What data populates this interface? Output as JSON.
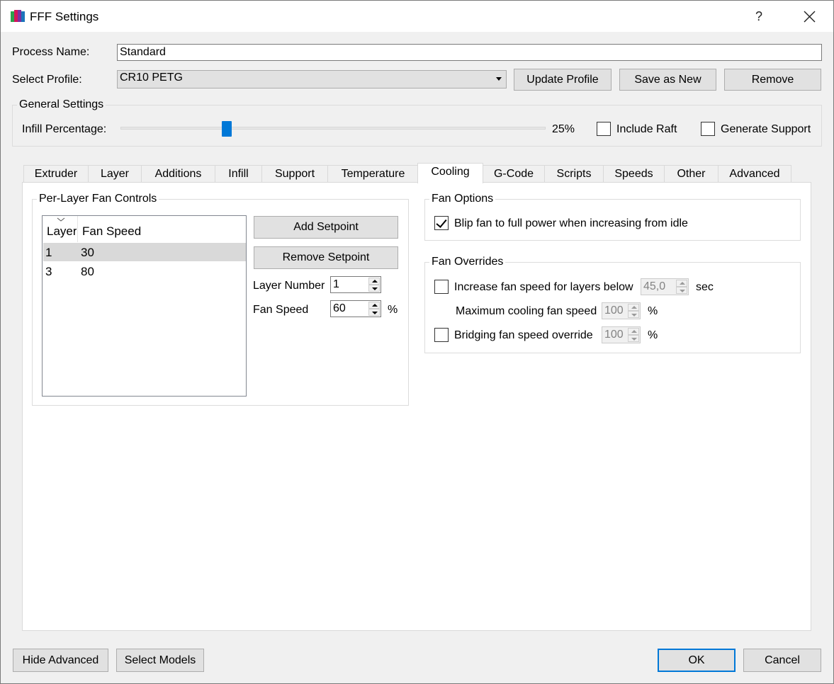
{
  "window": {
    "title": "FFF Settings",
    "help_label": "?",
    "close_icon": "close-icon",
    "app_icon": "simplify3d-icon"
  },
  "process": {
    "name_label": "Process Name:",
    "name_value": "Standard",
    "profile_label": "Select Profile:",
    "profile_value": "CR10 PETG",
    "update_profile": "Update Profile",
    "save_as_new": "Save as New",
    "remove": "Remove"
  },
  "general_settings": {
    "title": "General Settings",
    "infill_label": "Infill Percentage:",
    "infill_value": "25%",
    "infill_percent": 25,
    "include_raft": {
      "label": "Include Raft",
      "checked": false
    },
    "generate_support": {
      "label": "Generate Support",
      "checked": false
    }
  },
  "tabs": [
    {
      "label": "Extruder",
      "active": false
    },
    {
      "label": "Layer",
      "active": false
    },
    {
      "label": "Additions",
      "active": false
    },
    {
      "label": "Infill",
      "active": false
    },
    {
      "label": "Support",
      "active": false
    },
    {
      "label": "Temperature",
      "active": false
    },
    {
      "label": "Cooling",
      "active": true
    },
    {
      "label": "G-Code",
      "active": false
    },
    {
      "label": "Scripts",
      "active": false
    },
    {
      "label": "Speeds",
      "active": false
    },
    {
      "label": "Other",
      "active": false
    },
    {
      "label": "Advanced",
      "active": false
    }
  ],
  "per_layer": {
    "title": "Per-Layer Fan Controls",
    "columns": [
      "Layer",
      "Fan Speed"
    ],
    "rows": [
      {
        "layer": "1",
        "fan_speed": "30",
        "selected": true
      },
      {
        "layer": "3",
        "fan_speed": "80",
        "selected": false
      }
    ],
    "add_setpoint": "Add Setpoint",
    "remove_setpoint": "Remove Setpoint",
    "layer_number_label": "Layer Number",
    "layer_number_value": "1",
    "fan_speed_label": "Fan Speed",
    "fan_speed_value": "60",
    "fan_speed_unit": "%"
  },
  "fan_options": {
    "title": "Fan Options",
    "blip": {
      "label": "Blip fan to full power when increasing from idle",
      "checked": true
    }
  },
  "fan_overrides": {
    "title": "Fan Overrides",
    "increase": {
      "label": "Increase fan speed for layers below",
      "checked": false,
      "value": "45,0",
      "unit": "sec"
    },
    "max_cooling": {
      "label": "Maximum cooling fan speed",
      "value": "100",
      "unit": "%"
    },
    "bridging": {
      "label": "Bridging fan speed override",
      "checked": false,
      "value": "100",
      "unit": "%"
    }
  },
  "footer": {
    "hide_advanced": "Hide Advanced",
    "select_models": "Select Models",
    "ok": "OK",
    "cancel": "Cancel"
  }
}
